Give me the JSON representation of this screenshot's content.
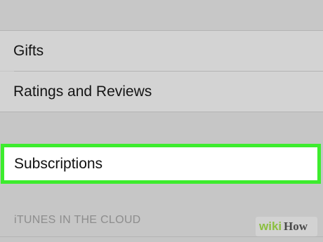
{
  "settings_list": {
    "rows": [
      {
        "label": "Gifts"
      },
      {
        "label": "Ratings and Reviews"
      }
    ],
    "highlighted_row": {
      "label": "Subscriptions"
    },
    "section_header": "iTUNES IN THE CLOUD"
  },
  "watermark": {
    "part1": "wiki",
    "part2": "How"
  },
  "colors": {
    "highlight_border": "#3dec2e",
    "row_background": "#d3d3d3",
    "page_background": "#c6c6c6"
  }
}
